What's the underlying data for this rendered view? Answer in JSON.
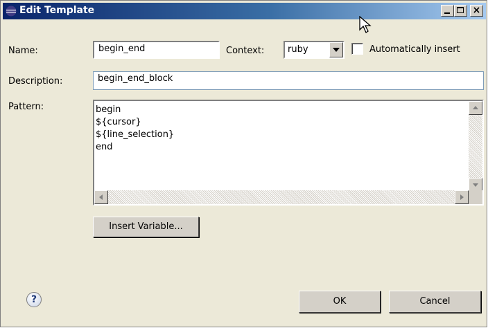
{
  "window": {
    "title": "Edit Template",
    "controls": {
      "minimize": "_",
      "maximize": "",
      "close": "×"
    }
  },
  "form": {
    "name_label": "Name:",
    "name_value": "begin_end",
    "context_label": "Context:",
    "context_value": "ruby",
    "auto_insert_label": "Automatically insert",
    "auto_insert_checked": false,
    "description_label": "Description:",
    "description_value": "begin_end_block",
    "pattern_label": "Pattern:",
    "pattern_lines": [
      "begin",
      "${cursor}",
      "${line_selection}",
      "end"
    ]
  },
  "buttons": {
    "insert_variable": "Insert Variable...",
    "ok": "OK",
    "cancel": "Cancel",
    "help": "?"
  },
  "icons": [
    "eclipse-app-icon",
    "mouse-cursor-icon",
    "help-icon",
    "chevron-down-icon",
    "scroll-up-arrow-icon",
    "scroll-down-arrow-icon",
    "scroll-left-arrow-icon",
    "scroll-right-arrow-icon"
  ],
  "colors": {
    "titlebar_start": "#0a246a",
    "titlebar_end": "#a6caf0",
    "dialog_bg": "#ece9d8"
  }
}
